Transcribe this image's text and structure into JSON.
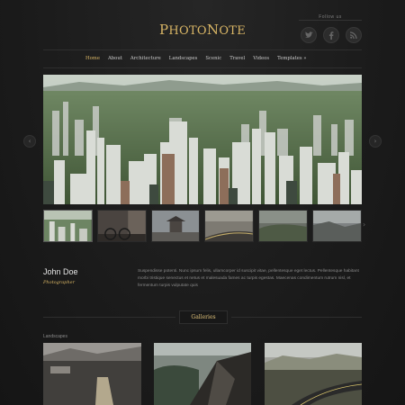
{
  "site": {
    "logo_first": "P",
    "logo_rest": "HOTO",
    "logo_second": "N",
    "logo_rest2": "OTE"
  },
  "follow": {
    "label": "Follow us",
    "icons": [
      "twitter-icon",
      "facebook-icon",
      "rss-icon"
    ]
  },
  "nav": {
    "items": [
      "Home",
      "About",
      "Architecture",
      "Landscapes",
      "Scenic",
      "Travel",
      "Videos",
      "Templates »"
    ],
    "active": "Home"
  },
  "slider": {
    "thumbnails": 6,
    "active_thumbnail": 1
  },
  "profile": {
    "name": "John Doe",
    "role": "Photographer",
    "bio": "Suspendisse potenti. Nunc ipsum felis, ullamcorper id suscipit vitae, pellentesque eget lectus. Pellentesque habitant morbi tristique senectus et netus et malesuada fames ac turpis egestas. Maecenas condimentum rutrum nisl, et fermentum turpis vulputate quis"
  },
  "galleries": {
    "title": "Galleries",
    "section_label": "Landscapes"
  },
  "colors": {
    "accent": "#d8b565",
    "background": "#1b1b1b"
  }
}
